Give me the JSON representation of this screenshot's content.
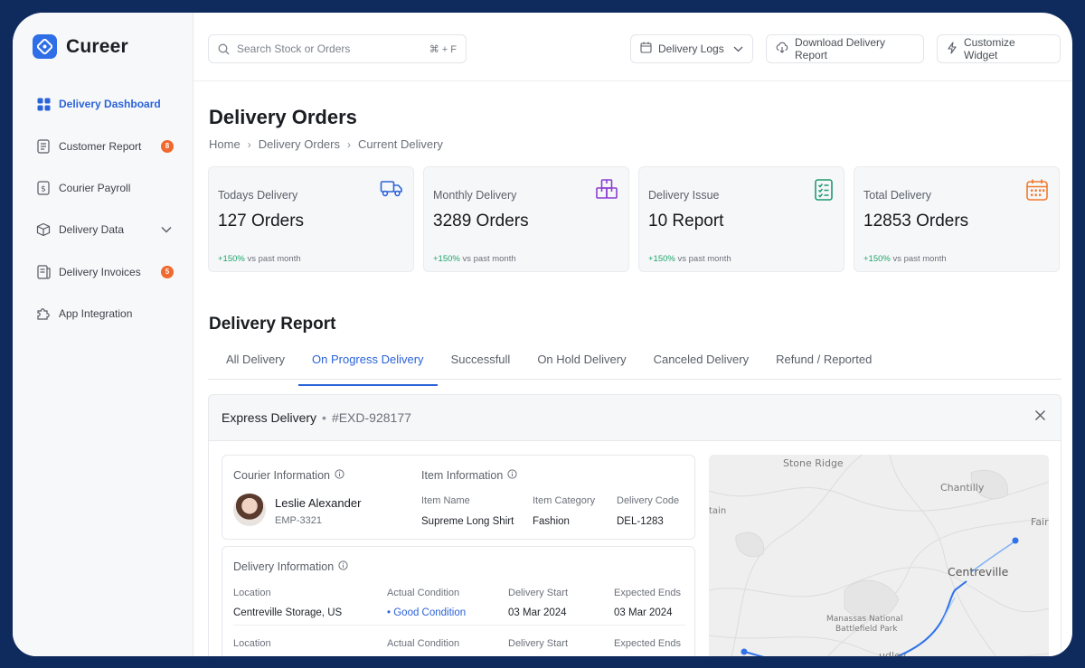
{
  "brand": {
    "name": "Cureer"
  },
  "sidebar": {
    "items": [
      {
        "label": "Delivery Dashboard",
        "icon": "grid-icon",
        "active": true
      },
      {
        "label": "Customer Report",
        "icon": "report-icon",
        "badge": "8"
      },
      {
        "label": "Courier Payroll",
        "icon": "payroll-icon"
      },
      {
        "label": "Delivery Data",
        "icon": "box-icon",
        "expandable": true
      },
      {
        "label": "Delivery Invoices",
        "icon": "invoice-icon",
        "badge": "5"
      },
      {
        "label": "App Integration",
        "icon": "puzzle-icon"
      }
    ]
  },
  "topbar": {
    "search_placeholder": "Search Stock or Orders",
    "search_shortcut": "⌘ + F",
    "delivery_logs": "Delivery Logs",
    "download_report": "Download Delivery Report",
    "customize_widget": "Customize Widget"
  },
  "page": {
    "title": "Delivery Orders",
    "breadcrumb": [
      "Home",
      "Delivery Orders",
      "Current Delivery"
    ]
  },
  "stats": [
    {
      "label": "Todays Delivery",
      "value": "127 Orders",
      "change": "+150%",
      "change_suffix": "vs past month",
      "icon": "truck-icon",
      "color": "#2b63d9"
    },
    {
      "label": "Monthly Delivery",
      "value": "3289 Orders",
      "change": "+150%",
      "change_suffix": "vs past month",
      "icon": "boxes-icon",
      "color": "#8b3fd1"
    },
    {
      "label": "Delivery Issue",
      "value": "10 Report",
      "change": "+150%",
      "change_suffix": "vs past month",
      "icon": "checklist-icon",
      "color": "#1e9a6e"
    },
    {
      "label": "Total Delivery",
      "value": "12853 Orders",
      "change": "+150%",
      "change_suffix": "vs past month",
      "icon": "calendar-icon",
      "color": "#ef7a2f"
    }
  ],
  "report": {
    "title": "Delivery Report",
    "tabs": [
      "All Delivery",
      "On Progress Delivery",
      "Successfull",
      "On Hold Delivery",
      "Canceled Delivery",
      "Refund / Reported"
    ],
    "active_tab": 1
  },
  "express": {
    "title": "Express Delivery",
    "code": "#EXD-928177",
    "courier": {
      "title": "Courier Information",
      "name": "Leslie Alexander",
      "id": "EMP-3321"
    },
    "item": {
      "title": "Item Information",
      "name_label": "Item Name",
      "name": "Supreme Long Shirt",
      "category_label": "Item Category",
      "category": "Fashion",
      "code_label": "Delivery Code",
      "code": "DEL-1283"
    },
    "delivery": {
      "title": "Delivery Information",
      "headers": [
        "Location",
        "Actual Condition",
        "Delivery Start",
        "Expected Ends"
      ],
      "rows": [
        {
          "location": "Centreville Storage, US",
          "condition": "Good Condition",
          "start": "03 Mar 2024",
          "end": "03 Mar 2024"
        }
      ]
    },
    "map": {
      "labels": [
        "Stone Ridge",
        "Chantilly",
        "tain",
        "Fair",
        "Centreville",
        "Manassas National",
        "Battlefield Park",
        "udley"
      ]
    }
  }
}
